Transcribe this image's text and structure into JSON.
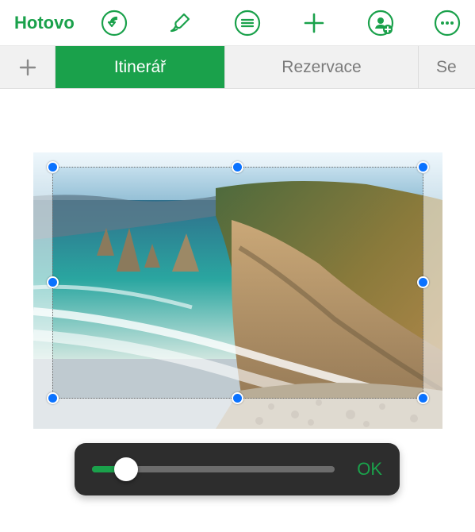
{
  "colors": {
    "accent_green": "#1aa14b",
    "handle_blue": "#0a72ff"
  },
  "toolbar": {
    "done_label": "Hotovo"
  },
  "tabs": {
    "items": [
      {
        "label": "Itinerář",
        "active": true
      },
      {
        "label": "Rezervace",
        "active": false
      },
      {
        "label": "Se",
        "active": false
      }
    ]
  },
  "mask_bar": {
    "slider_value": 0.14,
    "ok_label": "OK"
  }
}
